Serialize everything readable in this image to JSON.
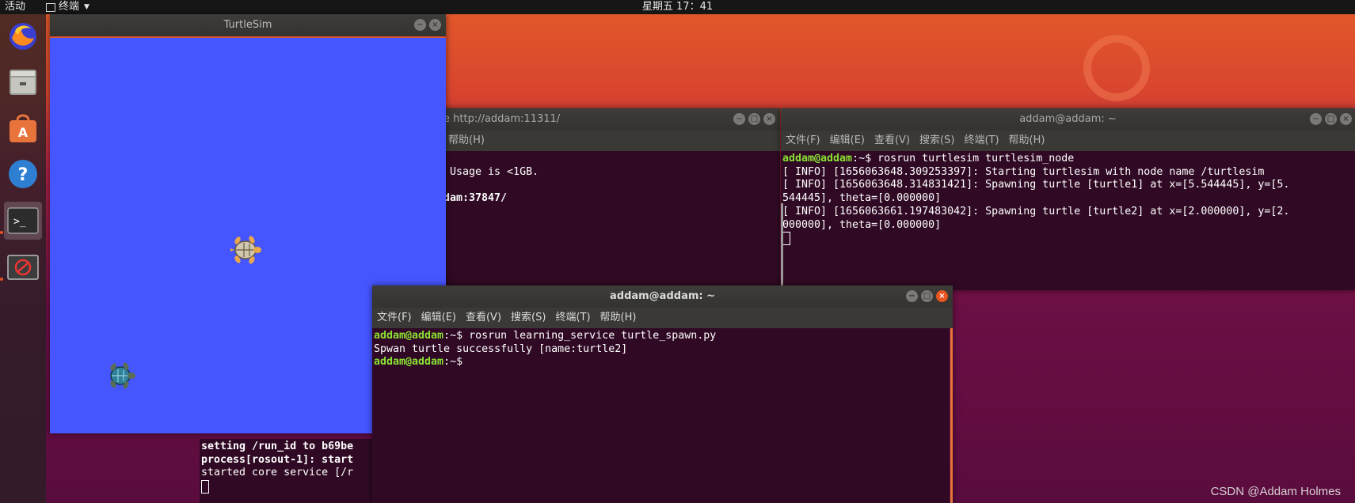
{
  "topbar": {
    "activities": "活动",
    "app_name": "终端",
    "clock": "星期五 17：41"
  },
  "dock": [
    "firefox-icon",
    "files-icon",
    "software-center-icon",
    "help-icon",
    "terminal-icon",
    "blocked-icon"
  ],
  "turtlesim": {
    "title": "TurtleSim",
    "background": "#4656ff"
  },
  "roscore_window": {
    "title": "e http://addam:11311/",
    "menu_help": "帮助(H)",
    "lines": [
      "",
      " Usage is <1GB.",
      "",
      "dam:37847/"
    ]
  },
  "node_window": {
    "title": "addam@addam: ~",
    "menus": [
      "文件(F)",
      "编辑(E)",
      "查看(V)",
      "搜索(S)",
      "终端(T)",
      "帮助(H)"
    ],
    "prompt": "addam@addam",
    "prompt_tail": ":~$ rosrun turtlesim turtlesim_node",
    "lines": [
      "[ INFO] [1656063648.309253397]: Starting turtlesim with node name /turtlesim",
      "[ INFO] [1656063648.314831421]: Spawning turtle [turtle1] at x=[5.544445], y=[5.",
      "544445], theta=[0.000000]",
      "[ INFO] [1656063661.197483042]: Spawning turtle [turtle2] at x=[2.000000], y=[2.",
      "000000], theta=[0.000000]"
    ]
  },
  "bottom_terminal": {
    "lines": [
      "setting /run_id to b69be",
      "process[rosout-1]: start",
      "started core service [/r"
    ]
  },
  "spawn_window": {
    "title": "addam@addam: ~",
    "menus": [
      "文件(F)",
      "编辑(E)",
      "查看(V)",
      "搜索(S)",
      "终端(T)",
      "帮助(H)"
    ],
    "prompt": "addam@addam",
    "line1_tail": ":~$ rosrun learning_service turtle_spawn.py",
    "line2": "Spwan turtle successfully [name:turtle2]",
    "line3_tail": ":~$"
  },
  "watermark": "CSDN @Addam Holmes",
  "colors": {
    "terminal_bg": "#300a24",
    "prompt_green": "#8ae234",
    "ubuntu_orange": "#e95420"
  }
}
